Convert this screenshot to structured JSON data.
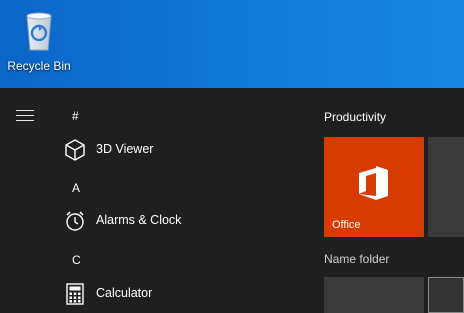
{
  "desktop": {
    "recycle_bin_label": "Recycle Bin"
  },
  "start_menu": {
    "hamburger_icon": "hamburger-menu-icon",
    "groups": [
      {
        "letter": "#",
        "apps": [
          {
            "label": "3D Viewer",
            "icon": "cube-icon"
          }
        ]
      },
      {
        "letter": "A",
        "apps": [
          {
            "label": "Alarms & Clock",
            "icon": "alarm-clock-icon"
          }
        ]
      },
      {
        "letter": "C",
        "apps": [
          {
            "label": "Calculator",
            "icon": "calculator-icon"
          }
        ]
      }
    ],
    "tiles": {
      "group_title": "Productivity",
      "office_label": "Office",
      "office_color": "#d83b01",
      "folder_label": "Name folder"
    }
  }
}
